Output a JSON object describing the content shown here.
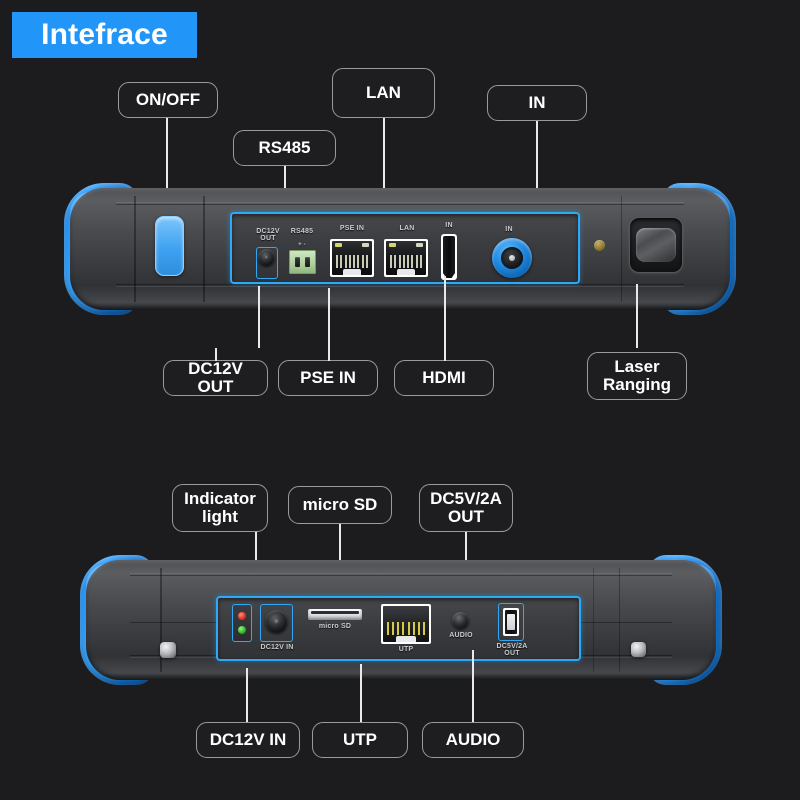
{
  "page": {
    "title": "Intefrace",
    "background_color": "#1c1c1e",
    "accent_color": "#2196f8",
    "callout_border_color": "#9a9a9e",
    "leader_color": "#e9e9ec"
  },
  "top_device": {
    "name": "top-edge-interface-view",
    "callouts_above": [
      {
        "id": "on-off",
        "label": "ON/OFF"
      },
      {
        "id": "rs485",
        "label": "RS485"
      },
      {
        "id": "lan",
        "label": "LAN"
      },
      {
        "id": "in",
        "label": "IN"
      }
    ],
    "callouts_below": [
      {
        "id": "dc12v-out",
        "label": "DC12V OUT"
      },
      {
        "id": "pse-in",
        "label": "PSE IN"
      },
      {
        "id": "hdmi",
        "label": "HDMI"
      },
      {
        "id": "laser-ranging",
        "label": "Laser\nRanging"
      }
    ],
    "port_silkscreen": [
      {
        "id": "dc12v-out-silk",
        "text": "DC12V\nOUT"
      },
      {
        "id": "rs485-silk",
        "text": "RS485"
      },
      {
        "id": "rs485-polarity",
        "text": "+    -"
      },
      {
        "id": "pse-in-silk",
        "text": "PSE IN"
      },
      {
        "id": "lan-silk",
        "text": "LAN"
      },
      {
        "id": "hdmi-silk",
        "text": "IN"
      },
      {
        "id": "bnc-in-silk",
        "text": "IN"
      }
    ]
  },
  "bottom_device": {
    "name": "bottom-edge-interface-view",
    "callouts_above": [
      {
        "id": "indicator-light",
        "label": "Indicator\nlight"
      },
      {
        "id": "micro-sd",
        "label": "micro SD"
      },
      {
        "id": "dc5v-2a-out",
        "label": "DC5V/2A\nOUT"
      }
    ],
    "callouts_below": [
      {
        "id": "dc12v-in",
        "label": "DC12V IN"
      },
      {
        "id": "utp",
        "label": "UTP"
      },
      {
        "id": "audio",
        "label": "AUDIO"
      }
    ],
    "port_silkscreen": [
      {
        "id": "dc12v-in-silk",
        "text": "DC12V IN"
      },
      {
        "id": "micro-sd-silk",
        "text": "micro SD"
      },
      {
        "id": "utp-silk",
        "text": "UTP"
      },
      {
        "id": "audio-silk",
        "text": "AUDIO"
      },
      {
        "id": "dc5v-2a-out-silk",
        "text": "DC5V/2A\nOUT"
      }
    ]
  }
}
